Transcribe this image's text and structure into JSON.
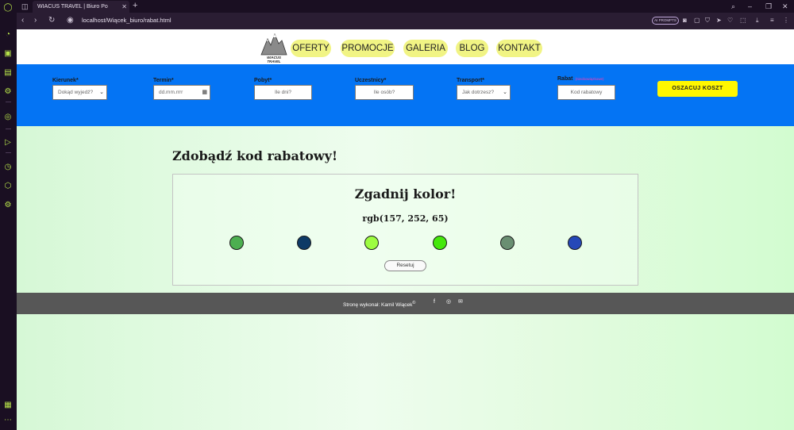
{
  "browser": {
    "tab_title": "WIACUS TRAVEL | Biuro Po",
    "tab_close": "✕",
    "new_tab": "+",
    "url": "localhost/Wiącek_biuro/rabat.html",
    "ai_badge": "AI PROMPTS"
  },
  "header": {
    "logo_text": "WIACUS\nTRAVEL",
    "nav": [
      "OFERTY",
      "PROMOCJE",
      "GALERIA",
      "BLOG",
      "KONTAKT"
    ]
  },
  "booking": {
    "kierunek": {
      "label": "Kierunek*",
      "value": "Dokąd wyjedź?"
    },
    "termin": {
      "label": "Termin*",
      "value": "dd.mm.rrrr"
    },
    "pobyt": {
      "label": "Pobyt*",
      "placeholder": "Ile dni?"
    },
    "uczestnicy": {
      "label": "Uczestnicy*",
      "placeholder": "Ile osób?"
    },
    "transport": {
      "label": "Transport*",
      "value": "Jak dotrzesz?"
    },
    "rabat": {
      "label": "Rabat",
      "hint": "(nieobowiązkowe)",
      "placeholder": "Kod rabatowy"
    },
    "estimate_button": "OSZACUJ KOSZT"
  },
  "main": {
    "heading": "Zdobądź kod rabatowy!",
    "game": {
      "title": "Zgadnij kolor!",
      "rgb_text": "rgb(157, 252, 65)",
      "swatches": [
        "#4caf50",
        "#0e3a66",
        "#9dfc41",
        "#45e80c",
        "#6a8f72",
        "#2548b8"
      ],
      "reset_label": "Resetuj"
    }
  },
  "footer": {
    "credit": "Stronę wykonał: Kamil Wiącek",
    "copyright": "©"
  }
}
